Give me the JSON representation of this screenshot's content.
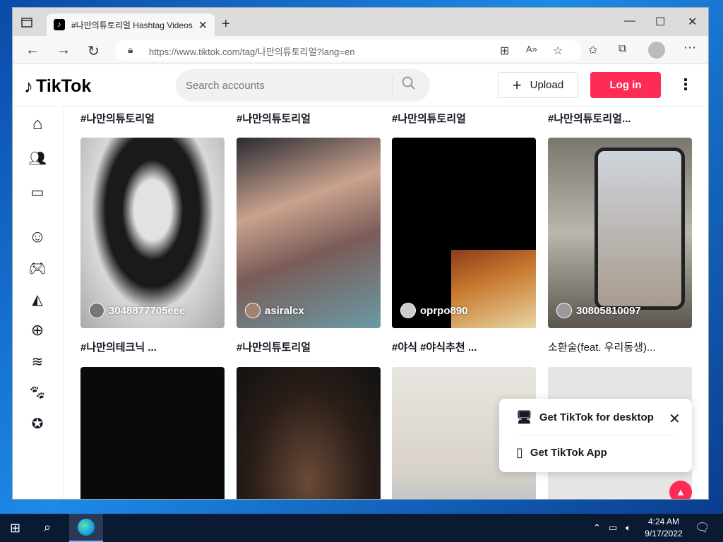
{
  "browser": {
    "tab_title": "#나만의튜토리얼 Hashtag Videos",
    "new_tab": "+",
    "url": "https://www.tiktok.com/tag/나만의튜토리얼?lang=en",
    "window": {
      "minimize": "—",
      "maximize": "☐",
      "close": "✕"
    }
  },
  "tiktok": {
    "logo_text": "TikTok",
    "search_placeholder": "Search accounts",
    "upload_label": "Upload",
    "login_label": "Log in",
    "sidebar_icons": [
      "home-icon",
      "following-icon",
      "live-icon",
      "comedy-icon",
      "gaming-icon",
      "food-icon",
      "sports-icon",
      "beauty-icon",
      "animals-icon",
      "achievement-icon"
    ],
    "top_labels": [
      "#나만의튜토리얼",
      "#나만의튜토리얼",
      "#나만의튜토리얼",
      "#나만의튜토리얼..."
    ],
    "videos": [
      {
        "username": "3048877705eee",
        "caption": "#나만의테크닉 ..."
      },
      {
        "username": "asiralcx",
        "caption": "#나만의튜토리얼"
      },
      {
        "username": "oprpo890",
        "caption": "#야식 #야식추천 ..."
      },
      {
        "username": "30805810097",
        "caption": "소환술(feat. 우리동생)..."
      }
    ],
    "popup": {
      "desktop": "Get TikTok for desktop",
      "app": "Get TikTok App"
    }
  },
  "taskbar": {
    "time": "4:24 AM",
    "date": "9/17/2022"
  },
  "colors": {
    "accent": "#fe2c55",
    "text": "#161823"
  }
}
